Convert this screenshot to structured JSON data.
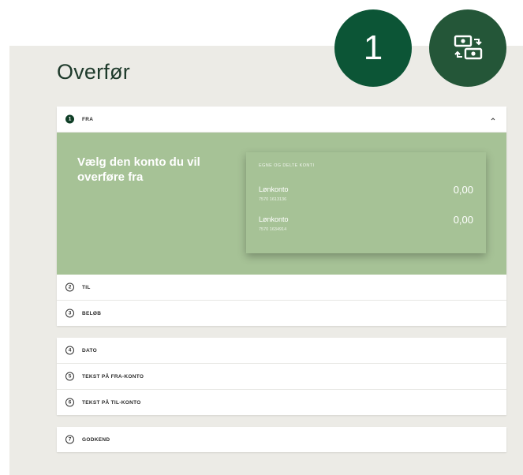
{
  "page": {
    "title": "Overfør"
  },
  "badges": {
    "step_number": "1",
    "icon": "money-transfer-icon"
  },
  "colors": {
    "panel_bg": "#ecebe6",
    "badge_dark_green": "#0c5536",
    "badge_icon_green": "#245638",
    "section_green": "#a6c296",
    "title_text": "#1e3a2b"
  },
  "fra": {
    "step": "1",
    "label": "FRA",
    "prompt": "Vælg den konto du vil overføre fra",
    "accounts_header": "EGNE OG DELTE KONTI",
    "accounts": [
      {
        "name": "Lønkonto",
        "number": "7570 1613136",
        "balance": "0,00"
      },
      {
        "name": "Lønkonto",
        "number": "7570 1634914",
        "balance": "0,00"
      }
    ]
  },
  "steps_a": [
    {
      "step": "2",
      "label": "TIL"
    },
    {
      "step": "3",
      "label": "BELØB"
    }
  ],
  "steps_b": [
    {
      "step": "4",
      "label": "DATO"
    },
    {
      "step": "5",
      "label": "TEKST PÅ FRA-KONTO"
    },
    {
      "step": "6",
      "label": "TEKST PÅ TIL-KONTO"
    }
  ],
  "steps_c": [
    {
      "step": "7",
      "label": "GODKEND"
    }
  ]
}
